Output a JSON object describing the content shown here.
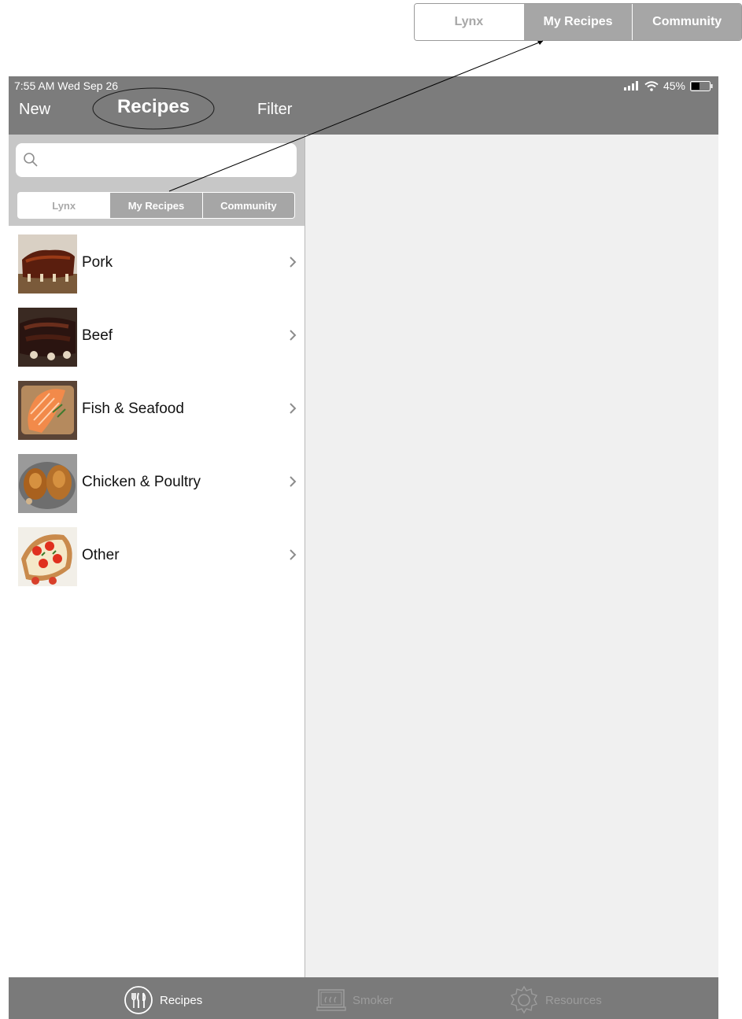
{
  "zoom_callout": {
    "segments": [
      "Lynx",
      "My Recipes",
      "Community"
    ],
    "selected_index": 1
  },
  "status_bar": {
    "time_date": "7:55 AM   Wed Sep 26",
    "battery": "45%",
    "battery_level": 0.45,
    "icons": [
      "signal-icon",
      "wifi-icon",
      "battery-icon"
    ]
  },
  "nav": {
    "left": "New",
    "title": "Recipes",
    "right": "Filter"
  },
  "search": {
    "placeholder": "",
    "value": ""
  },
  "segmented": {
    "segments": [
      "Lynx",
      "My Recipes",
      "Community"
    ],
    "selected_index": 1
  },
  "categories": [
    {
      "label": "Pork"
    },
    {
      "label": "Beef"
    },
    {
      "label": "Fish & Seafood"
    },
    {
      "label": "Chicken & Poultry"
    },
    {
      "label": "Other"
    }
  ],
  "tabs": [
    {
      "label": "Recipes",
      "icon": "utensils-icon",
      "active": true
    },
    {
      "label": "Smoker",
      "icon": "smoker-icon",
      "active": false
    },
    {
      "label": "Resources",
      "icon": "gear-icon",
      "active": false
    }
  ],
  "colors": {
    "bar_gray": "#7c7c7c",
    "search_area": "#c7c7c7",
    "segment_selected": "#a6a6a6",
    "detail_bg": "#f0f0f0"
  }
}
